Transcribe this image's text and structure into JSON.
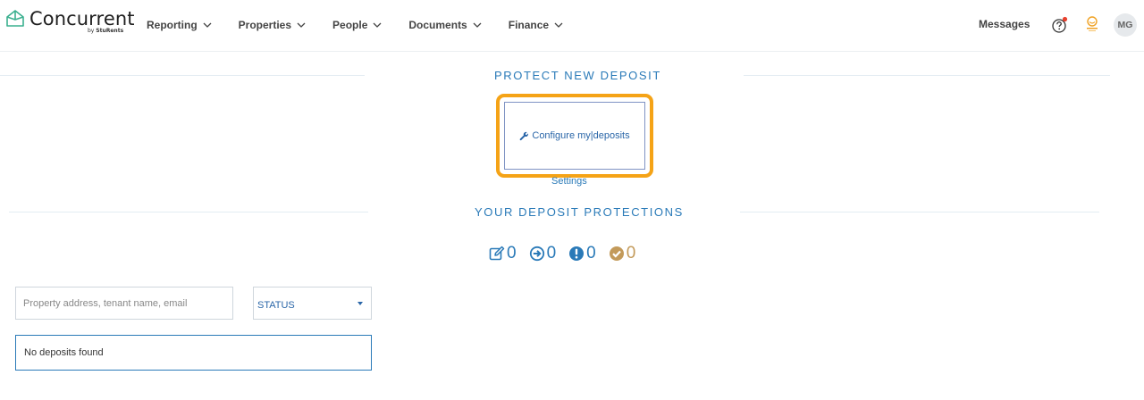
{
  "brand": {
    "name": "Concurrent",
    "sub_prefix": "by",
    "sub_name": "StuRents"
  },
  "nav": {
    "items": [
      {
        "label": "Reporting"
      },
      {
        "label": "Properties"
      },
      {
        "label": "People"
      },
      {
        "label": "Documents"
      },
      {
        "label": "Finance"
      }
    ],
    "messages_label": "Messages",
    "avatar_initials": "MG",
    "help_icon": "question-circle-icon",
    "notification_color": "#e8402d"
  },
  "protect": {
    "title": "PROTECT NEW DEPOSIT",
    "configure_button": "Configure my|deposits",
    "settings_link": "Settings"
  },
  "protections": {
    "title": "YOUR DEPOSIT PROTECTIONS",
    "counters": [
      {
        "icon": "edit-icon",
        "value": "0"
      },
      {
        "icon": "arrow-circle-right-icon",
        "value": "0"
      },
      {
        "icon": "exclamation-circle-icon",
        "value": "0"
      },
      {
        "icon": "check-circle-icon",
        "value": "0"
      }
    ]
  },
  "filters": {
    "search_placeholder": "Property address, tenant name, email",
    "status_label": "STATUS"
  },
  "results": {
    "empty_message": "No deposits found"
  },
  "colors": {
    "accent": "#2a7ab8",
    "highlight": "#f5a316",
    "done": "#c39a5a"
  }
}
